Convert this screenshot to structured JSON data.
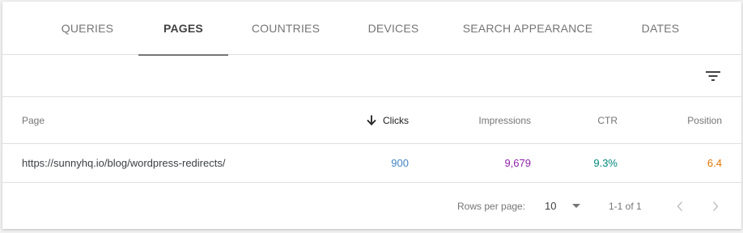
{
  "tabs": [
    {
      "label": "QUERIES",
      "active": false
    },
    {
      "label": "PAGES",
      "active": true
    },
    {
      "label": "COUNTRIES",
      "active": false
    },
    {
      "label": "DEVICES",
      "active": false
    },
    {
      "label": "SEARCH APPEARANCE",
      "active": false
    },
    {
      "label": "DATES",
      "active": false
    }
  ],
  "toolbar": {
    "filter_icon": "filter-list-icon"
  },
  "table": {
    "columns": {
      "page": "Page",
      "clicks": "Clicks",
      "impressions": "Impressions",
      "ctr": "CTR",
      "position": "Position"
    },
    "sort_icon": "arrow-downward-icon",
    "rows": [
      {
        "page": "https://sunnyhq.io/blog/wordpress-redirects/",
        "clicks": "900",
        "impressions": "9,679",
        "ctr": "9.3%",
        "position": "6.4"
      }
    ]
  },
  "colors": {
    "clicks": "#4285c4",
    "impressions": "#8e24aa",
    "ctr": "#00897b",
    "position": "#e37400"
  },
  "pagination": {
    "rows_per_page_label": "Rows per page:",
    "rows_per_page_value": "10",
    "range": "1-1 of 1",
    "prev_icon": "chevron-left-icon",
    "next_icon": "chevron-right-icon"
  }
}
